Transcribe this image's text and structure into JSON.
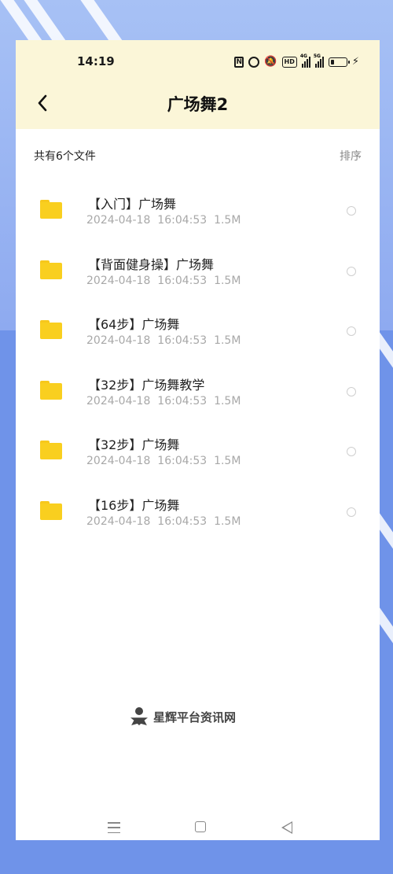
{
  "status_bar": {
    "time": "14:19",
    "net_1": "4G",
    "net_2": "5G"
  },
  "header": {
    "title": "广场舞2",
    "background": "#fbf6d8"
  },
  "summary": {
    "count_text": "共有6个文件",
    "sort_label": "排序"
  },
  "files": [
    {
      "name": "【入门】广场舞",
      "date": "2024-04-18",
      "time": "16:04:53",
      "size": "1.5M"
    },
    {
      "name": "【背面健身操】广场舞",
      "date": "2024-04-18",
      "time": "16:04:53",
      "size": "1.5M"
    },
    {
      "name": "【64步】广场舞",
      "date": "2024-04-18",
      "time": "16:04:53",
      "size": "1.5M"
    },
    {
      "name": "【32步】广场舞教学",
      "date": "2024-04-18",
      "time": "16:04:53",
      "size": "1.5M"
    },
    {
      "name": "【32步】广场舞",
      "date": "2024-04-18",
      "time": "16:04:53",
      "size": "1.5M"
    },
    {
      "name": "【16步】广场舞",
      "date": "2024-04-18",
      "time": "16:04:53",
      "size": "1.5M"
    }
  ],
  "icons": {
    "folder": "folder-icon",
    "back": "chevron-left-icon",
    "select": "radio-circle-icon"
  },
  "colors": {
    "folder": "#f9cf1f",
    "page_background": "#6f93e9"
  },
  "watermark": {
    "text": "星辉平台资讯网"
  }
}
